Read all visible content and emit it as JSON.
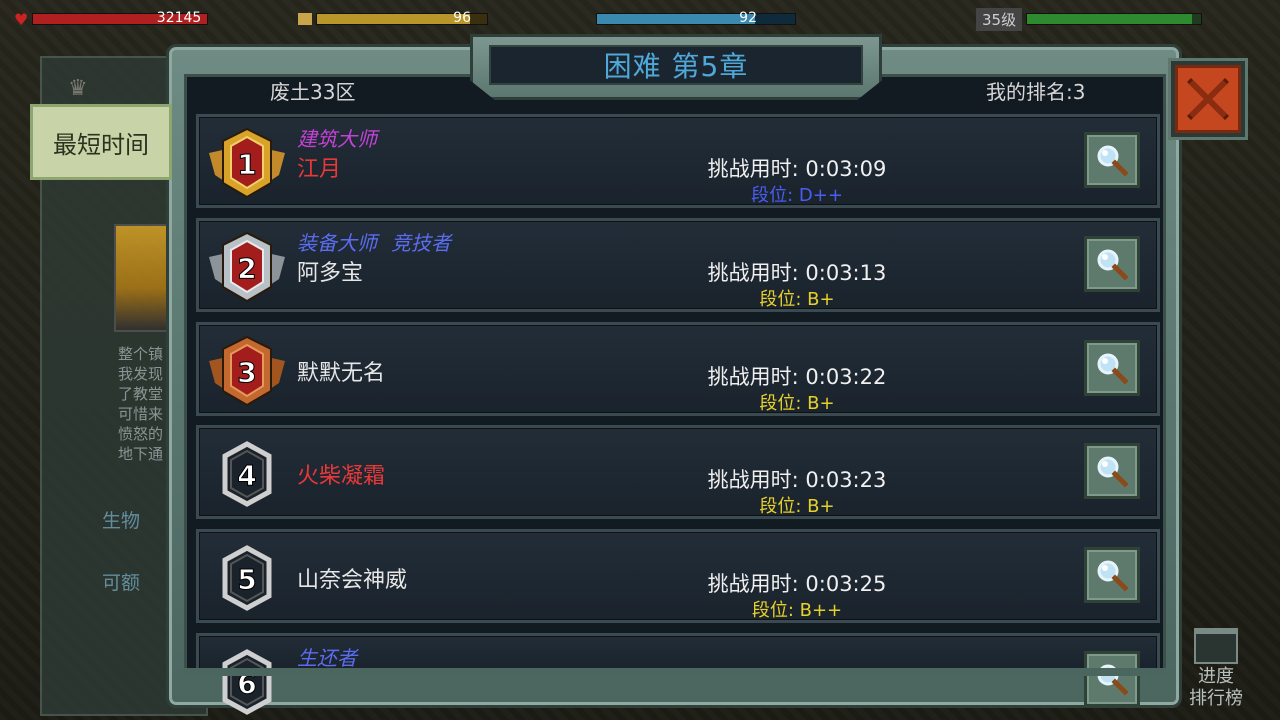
{
  "hud": {
    "hp_value": "32145",
    "food_value": "96",
    "water_value": "92",
    "level": "35级"
  },
  "background": {
    "side_tab_label": "最短时间",
    "story_lines": [
      "整个镇",
      "我发现",
      "了教堂",
      "可惜来",
      "愤怒的",
      "地下通"
    ],
    "link_1": "生物",
    "link_2": "可额",
    "progress_board_label": "进度\n排行榜"
  },
  "dialog": {
    "title": "困难 第5章",
    "server": "废土33区",
    "my_rank": "我的排名:3"
  },
  "colors": {
    "title_blue": "#4fa8d8",
    "tag_purple": "#c542d6",
    "tag_blue": "#5b6cf0",
    "name_red": "#e83838",
    "name_white": "#e6e6e6",
    "tier_blue": "#4a5cf2",
    "tier_yellow": "#e6d12a",
    "close_red": "#c4471f"
  },
  "leaderboard": [
    {
      "rank": "1",
      "badge": "gold",
      "titles": [
        {
          "text": "建筑大师",
          "color": "#c542d6"
        }
      ],
      "name": "江月",
      "name_color": "#e83838",
      "time_label": "挑战用时: 0:03:09",
      "tier_label": "段位: D++",
      "tier_color": "#4a5cf2"
    },
    {
      "rank": "2",
      "badge": "silver",
      "titles": [
        {
          "text": "装备大师",
          "color": "#5b6cf0"
        },
        {
          "text": "竞技者",
          "color": "#5b6cf0"
        }
      ],
      "name": "阿多宝",
      "name_color": "#e6e6e6",
      "time_label": "挑战用时: 0:03:13",
      "tier_label": "段位: B+",
      "tier_color": "#e6d12a"
    },
    {
      "rank": "3",
      "badge": "bronze",
      "titles": [],
      "name": "默默无名",
      "name_color": "#e6e6e6",
      "time_label": "挑战用时: 0:03:22",
      "tier_label": "段位: B+",
      "tier_color": "#e6d12a"
    },
    {
      "rank": "4",
      "badge": "plain",
      "titles": [],
      "name": "火柴凝霜",
      "name_color": "#e83838",
      "time_label": "挑战用时: 0:03:23",
      "tier_label": "段位: B+",
      "tier_color": "#e6d12a"
    },
    {
      "rank": "5",
      "badge": "plain",
      "titles": [],
      "name": "山奈会神威",
      "name_color": "#e6e6e6",
      "time_label": "挑战用时: 0:03:25",
      "tier_label": "段位: B++",
      "tier_color": "#e6d12a"
    },
    {
      "rank": "6",
      "badge": "plain",
      "titles": [
        {
          "text": "生还者",
          "color": "#5b6cf0"
        }
      ],
      "name": "",
      "name_color": "#e6e6e6",
      "time_label": "",
      "tier_label": "",
      "tier_color": "#e6d12a"
    }
  ]
}
